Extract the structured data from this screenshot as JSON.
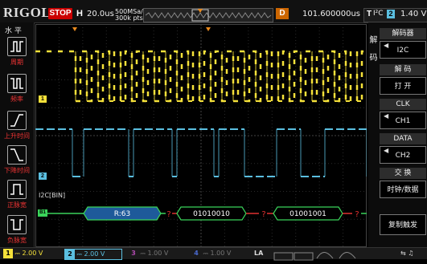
{
  "topbar": {
    "brand": "RIGOL",
    "run_state": "STOP",
    "timebase_label": "H",
    "timebase_value": "20.0us",
    "sample_rate": "500MSa/s",
    "mem_depth": "300k pts",
    "delay_label": "D",
    "delay_value": "101.600000us",
    "trigger_label": "T",
    "trigger_source": "I²C",
    "trigger_channel": "2",
    "trigger_level": "1.40 V"
  },
  "left_menu": {
    "header": "水 平",
    "items": [
      {
        "label": "周期",
        "icon": "period-pulse-icon"
      },
      {
        "label": "频率",
        "icon": "frequency-pulse-icon"
      },
      {
        "label": "上升时间",
        "icon": "rise-time-icon"
      },
      {
        "label": "下降时间",
        "icon": "fall-time-icon"
      },
      {
        "label": "正脉宽",
        "icon": "positive-width-icon"
      },
      {
        "label": "负脉宽",
        "icon": "negative-width-icon"
      }
    ]
  },
  "right_menu": {
    "side_title": "解码",
    "decoder_header": "解码器",
    "decoder_value": "I2C",
    "decode_header": "解 码",
    "decode_value": "打 开",
    "clk_header": "CLK",
    "clk_value": "CH1",
    "data_header": "DATA",
    "data_value": "CH2",
    "swap_header": "交 换",
    "swap_value": "时钟/数据",
    "copy_trigger": "复制触发"
  },
  "markers": {
    "ch1_marker": "1",
    "ch2_marker": "2",
    "bus_marker": "B1",
    "trigger_marker": "T"
  },
  "bus": {
    "label": "I2C[BIN]",
    "packets": [
      {
        "text": "R:63",
        "kind": "address"
      },
      {
        "text": "?",
        "kind": "ack"
      },
      {
        "text": "01010010",
        "kind": "data"
      },
      {
        "text": "?",
        "kind": "ack"
      },
      {
        "text": "01001001",
        "kind": "data"
      },
      {
        "text": "?",
        "kind": "ack"
      }
    ]
  },
  "bottombar": {
    "ch1": {
      "num": "1",
      "value": "2.00 V"
    },
    "ch2": {
      "num": "2",
      "value": "2.00 V"
    },
    "ch3": {
      "num": "3",
      "value": "1.00 V"
    },
    "ch4": {
      "num": "4",
      "value": "1.00 V"
    },
    "la": "LA",
    "usb": "⇆ ♫"
  },
  "colors": {
    "ch1": "#f5e13a",
    "ch2": "#5bbfe0",
    "bus_green": "#3ad35a",
    "bus_fill": "#1e5a9a",
    "accent_red": "#e03030"
  }
}
